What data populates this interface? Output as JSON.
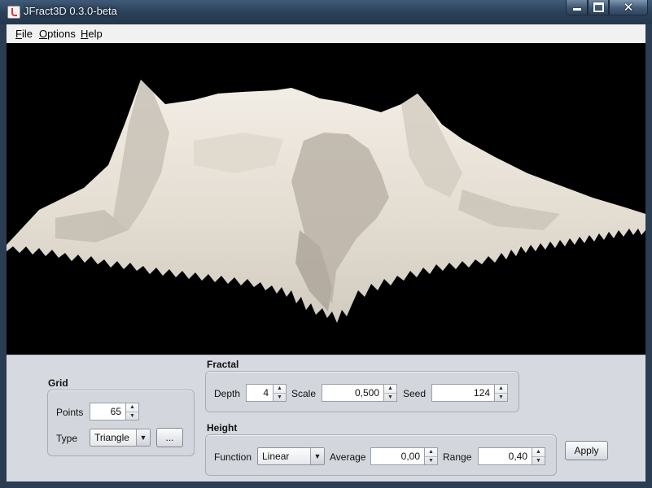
{
  "window": {
    "title": "JFract3D 0.3.0-beta"
  },
  "menu": {
    "file": {
      "mnemonic": "F",
      "rest": "ile"
    },
    "options": {
      "mnemonic": "O",
      "rest": "ptions"
    },
    "help": {
      "mnemonic": "H",
      "rest": "elp"
    }
  },
  "grid": {
    "title": "Grid",
    "points_label": "Points",
    "points_value": "65",
    "type_label": "Type",
    "type_value": "Triangle",
    "more_button": "..."
  },
  "fractal": {
    "title": "Fractal",
    "depth_label": "Depth",
    "depth_value": "4",
    "scale_label": "Scale",
    "scale_value": "0,500",
    "seed_label": "Seed",
    "seed_value": "124"
  },
  "height": {
    "title": "Height",
    "function_label": "Function",
    "function_value": "Linear",
    "average_label": "Average",
    "average_value": "0,00",
    "range_label": "Range",
    "range_value": "0,40"
  },
  "apply_button": "Apply",
  "colors": {
    "terrain_light": "#f2ede5",
    "terrain_mid": "#d9d2c7",
    "terrain_shadow": "#a8a196",
    "viewport_bg": "#000000"
  }
}
